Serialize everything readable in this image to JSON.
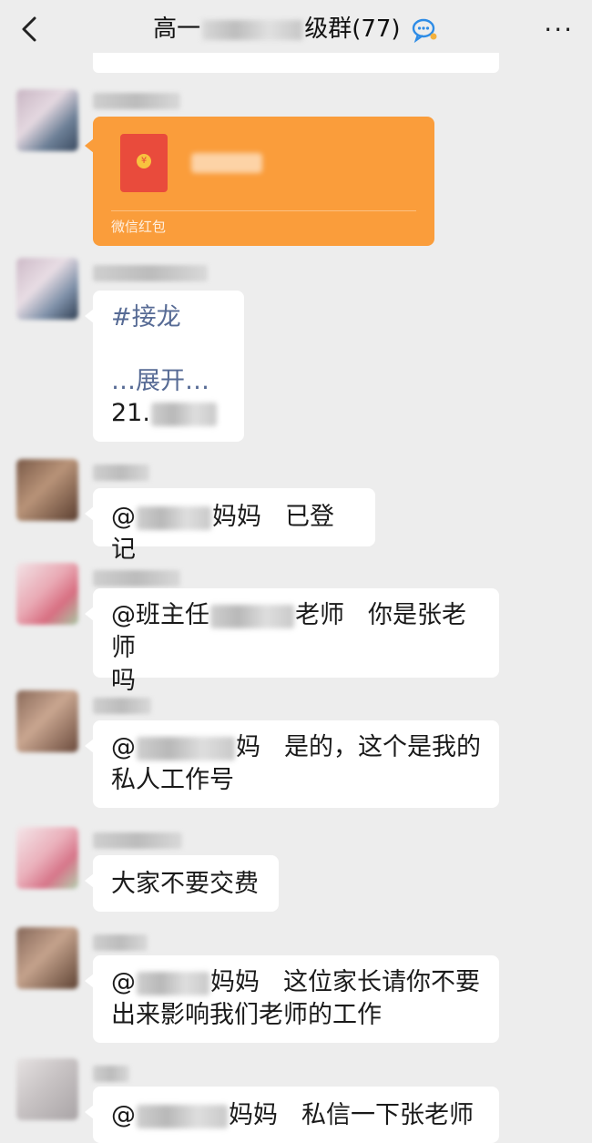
{
  "header": {
    "title_prefix": "高一",
    "title_suffix": "级群(77)",
    "more_label": "···"
  },
  "messages": [
    {
      "type": "red_packet",
      "label": "微信红包"
    },
    {
      "type": "text",
      "tag": "#接龙",
      "expand": "…展开…",
      "num_prefix": "21."
    },
    {
      "type": "text",
      "mention_prefix": "@",
      "mention_suffix": "妈妈",
      "body": "已登记"
    },
    {
      "type": "text",
      "line1_prefix": "@班主任",
      "line1_mid": "老师",
      "line1_body": "你是张老师",
      "line2": "吗"
    },
    {
      "type": "text",
      "mention_prefix": "@",
      "mention_suffix": "妈",
      "line1_body": "是的，这个是我的",
      "line2": "私人工作号"
    },
    {
      "type": "text",
      "body": "大家不要交费"
    },
    {
      "type": "text",
      "mention_prefix": "@",
      "mention_suffix": "妈妈",
      "line1_body": "这位家长请你不要",
      "line2": "出来影响我们老师的工作"
    },
    {
      "type": "text",
      "mention_prefix": "@",
      "mention_suffix": "妈妈",
      "body": "私信一下张老师"
    }
  ],
  "colors": {
    "background": "#ededed",
    "bubble": "#ffffff",
    "red_packet": "#fa9d3b",
    "link": "#576b95"
  },
  "icons": [
    "back-arrow-icon",
    "group-chat-icon",
    "more-icon",
    "red-packet-icon"
  ]
}
